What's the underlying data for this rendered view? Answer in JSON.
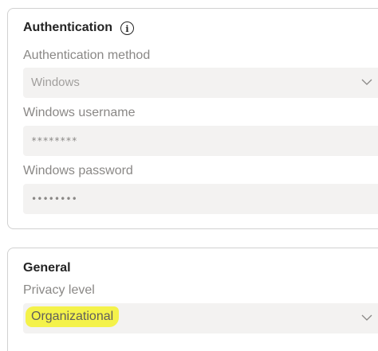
{
  "authentication": {
    "title": "Authentication",
    "info_icon": "info-icon",
    "method_label": "Authentication method",
    "method_value": "Windows",
    "username_label": "Windows username",
    "username_value": "********",
    "password_label": "Windows password",
    "password_value": "••••••••"
  },
  "general": {
    "title": "General",
    "privacy_label": "Privacy level",
    "privacy_value": "Organizational",
    "highlight_color": "#f4f24a"
  }
}
